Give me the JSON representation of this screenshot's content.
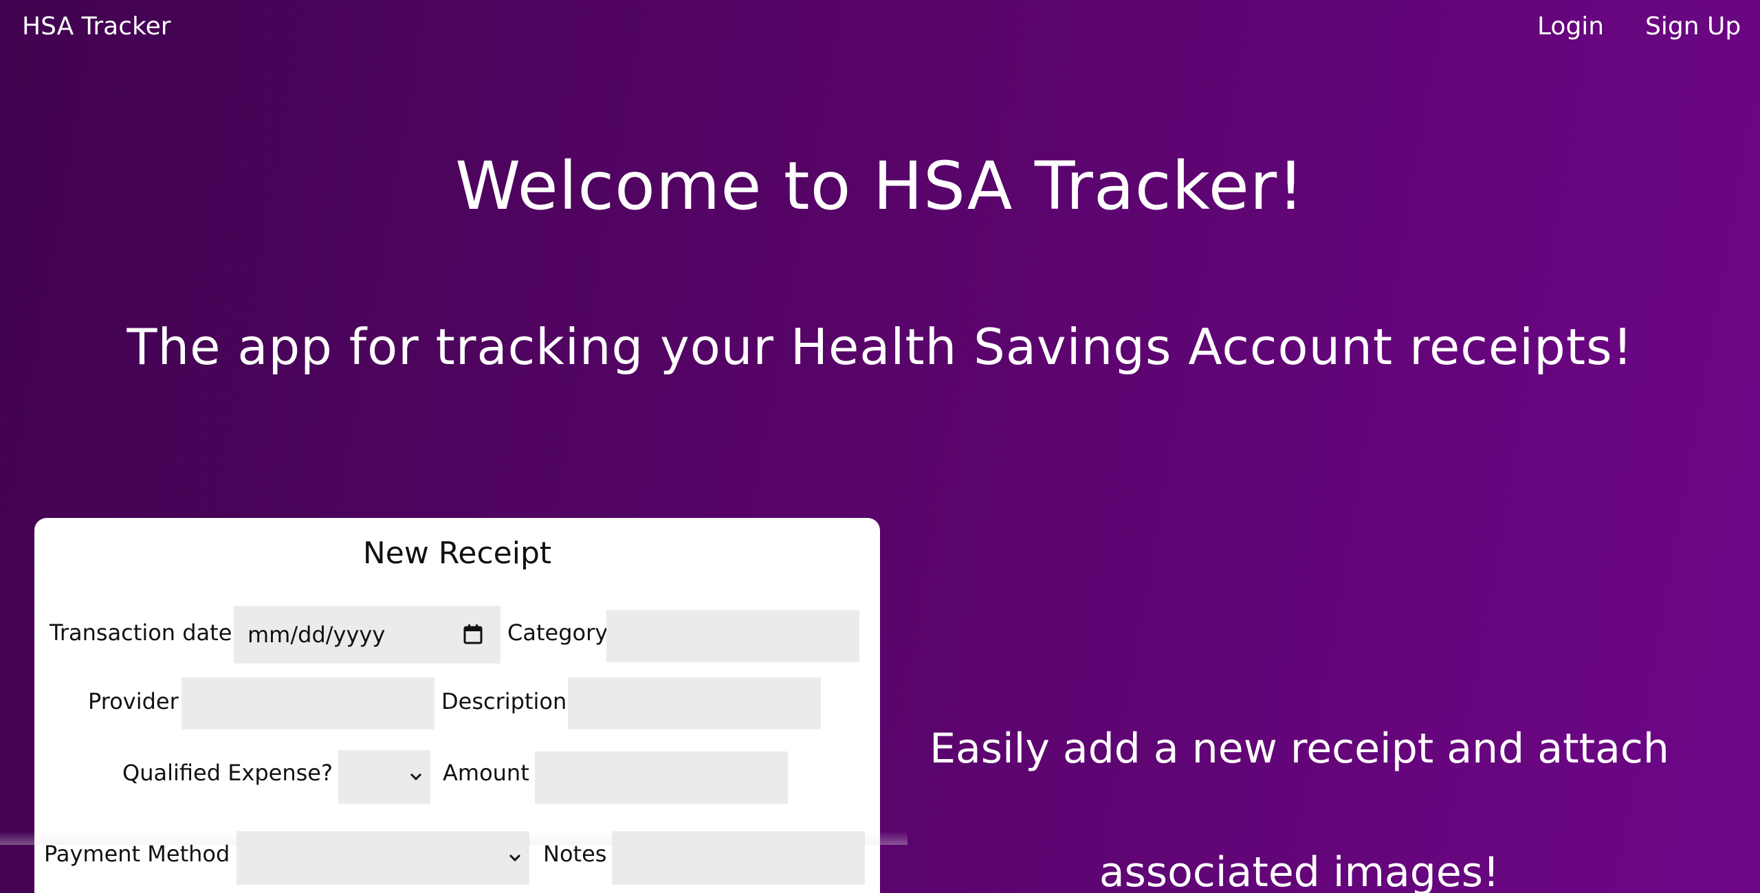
{
  "nav": {
    "brand": "HSA Tracker",
    "login": "Login",
    "signup": "Sign Up"
  },
  "hero": {
    "title": "Welcome to HSA Tracker!",
    "subtitle": "The app for tracking your Health Savings Account receipts!"
  },
  "form": {
    "title": "New Receipt",
    "fields": {
      "transaction_date": {
        "label": "Transaction date",
        "placeholder": "mm/dd/yyyy"
      },
      "category": {
        "label": "Category",
        "value": ""
      },
      "provider": {
        "label": "Provider",
        "value": ""
      },
      "description": {
        "label": "Description",
        "value": ""
      },
      "qualified_expense": {
        "label": "Qualified Expense?",
        "value": ""
      },
      "amount": {
        "label": "Amount",
        "value": ""
      },
      "payment_method": {
        "label": "Payment Method",
        "value": ""
      },
      "notes": {
        "label": "Notes",
        "value": ""
      }
    }
  },
  "promo": {
    "text": "Easily add a new receipt and attach associated images!"
  },
  "colors": {
    "gradient_start": "#410350",
    "gradient_end": "#6e0688",
    "card_background": "#ffffff",
    "input_background": "#ebebeb"
  },
  "icons": {
    "calendar": "calendar-icon",
    "select_chevron": "chevron-down-icon"
  }
}
